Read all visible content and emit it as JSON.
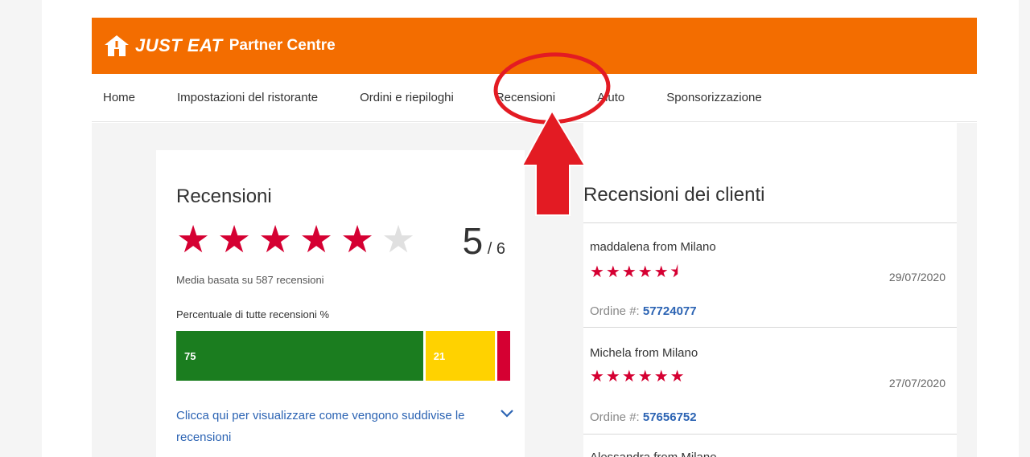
{
  "header": {
    "brand": "JUST EAT",
    "subtitle": "Partner Centre",
    "logo_icon": "just-eat-house-icon",
    "color": "#f36d00"
  },
  "nav": {
    "items": [
      {
        "label": "Home"
      },
      {
        "label": "Impostazioni del ristorante"
      },
      {
        "label": "Ordini e riepiloghi"
      },
      {
        "label": "Recensioni"
      },
      {
        "label": "Aiuto"
      },
      {
        "label": "Sponsorizzazione"
      }
    ]
  },
  "summary": {
    "title": "Recensioni",
    "stars_filled": 5,
    "stars_total": 6,
    "score": "5",
    "score_max": "/ 6",
    "media_text": "Media basata su 587 recensioni",
    "percent_label": "Percentuale di tutte recensioni %",
    "bar": [
      {
        "label": "75",
        "value": 75,
        "color": "#1b7d1f"
      },
      {
        "label": "21",
        "value": 21,
        "color": "#ffd200"
      },
      {
        "label": "",
        "value": 4,
        "color": "#d50032"
      }
    ],
    "expand_link": "Clicca qui per visualizzare come vengono suddivise le recensioni",
    "star_color": "#d50032"
  },
  "customer_reviews": {
    "title": "Recensioni dei clienti",
    "items": [
      {
        "name": "maddalena from Milano",
        "stars": "★★★★★⯨",
        "date": "29/07/2020",
        "order_label": "Ordine #:",
        "order_number": "57724077"
      },
      {
        "name": "Michela from Milano",
        "stars": "★★★★★★",
        "date": "27/07/2020",
        "order_label": "Ordine #:",
        "order_number": "57656752"
      },
      {
        "name": "Alessandra from Milano",
        "stars": "",
        "date": "",
        "order_label": "",
        "order_number": ""
      }
    ]
  },
  "annotation": {
    "color": "#e31b23"
  }
}
